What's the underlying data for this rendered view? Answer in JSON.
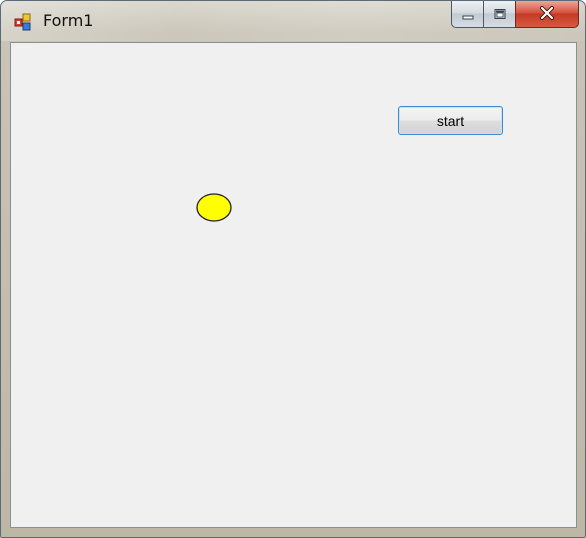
{
  "window": {
    "title": "Form1"
  },
  "caption": {
    "minimize_icon": "minimize-icon",
    "maximize_icon": "maximize-icon",
    "close_icon": "close-icon"
  },
  "form": {
    "start_label": "start",
    "ball_color": "#ffff00"
  }
}
